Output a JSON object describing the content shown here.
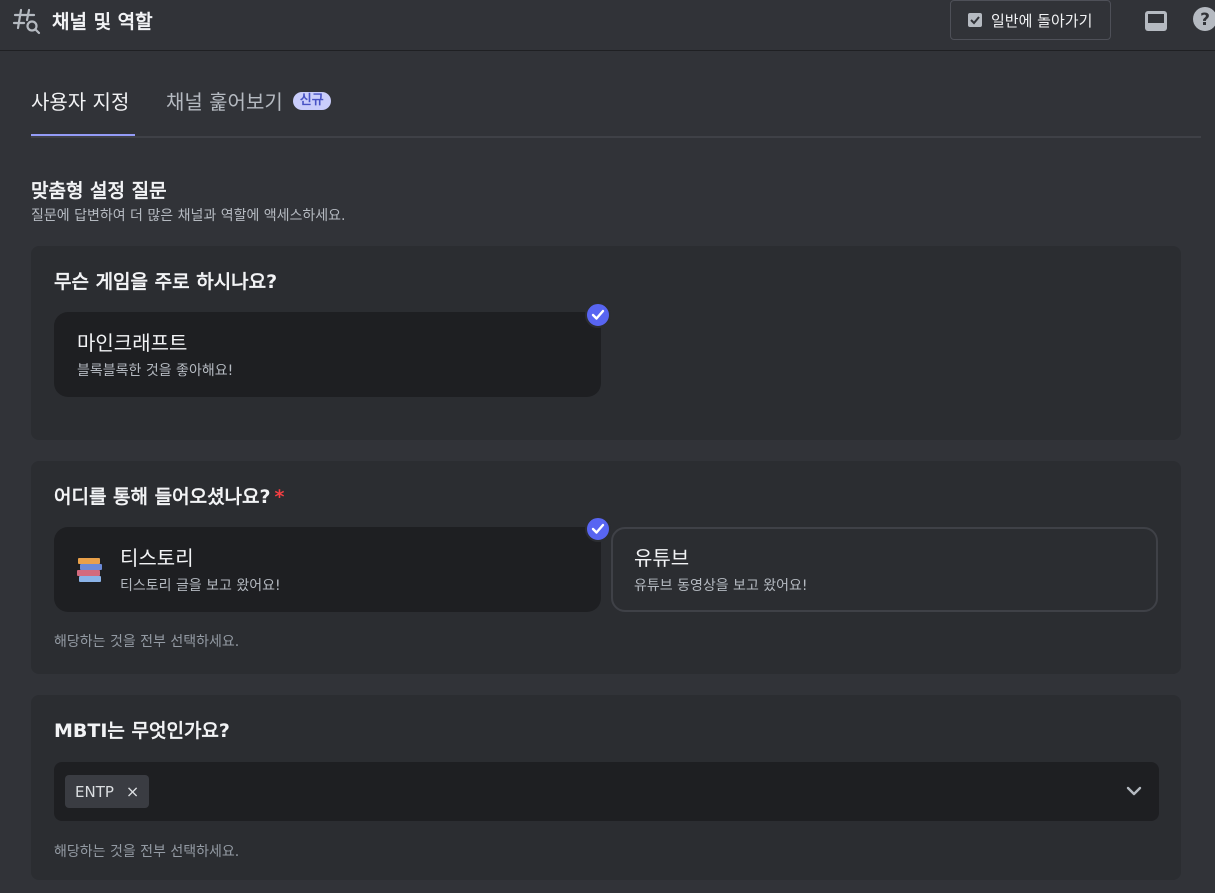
{
  "header": {
    "title": "채널 및 역할",
    "back_button_label": "일반에 돌아가기",
    "icons": [
      "hashtag-search-icon",
      "checkbox-icon",
      "inbox-icon",
      "help-icon"
    ]
  },
  "tabs": [
    {
      "label": "사용자 지정",
      "active": true
    },
    {
      "label": "채널 훑어보기",
      "badge": "신규",
      "active": false
    }
  ],
  "section": {
    "title": "맞춤형 설정 질문",
    "subtitle": "질문에 답변하여 더 많은 채널과 역할에 액세스하세요."
  },
  "questions": [
    {
      "title": "무슨 게임을 주로 하시나요?",
      "options": [
        {
          "title": "마인크래프트",
          "desc": "블록블록한 것을 좋아해요!",
          "selected": true
        }
      ]
    },
    {
      "title": "어디를 통해 들어오셨나요?",
      "required_mark": "*",
      "options": [
        {
          "title": "티스토리",
          "desc": "티스토리 글을 보고 왔어요!",
          "selected": true,
          "emoji": "books-icon"
        },
        {
          "title": "유튜브",
          "desc": "유튜브 동영상을 보고 왔어요!",
          "selected": false
        }
      ],
      "hint": "해당하는 것을 전부 선택하세요."
    },
    {
      "title": "MBTI는 무엇인가요?",
      "dropdown": {
        "selected_chips": [
          "ENTP"
        ],
        "remove_glyph": "×"
      },
      "hint": "해당하는 것을 전부 선택하세요."
    }
  ],
  "colors": {
    "accent": "#5865f2",
    "tab_underline": "#949cf7",
    "required": "#f23f43",
    "badge_bg": "#c9cdfb"
  }
}
